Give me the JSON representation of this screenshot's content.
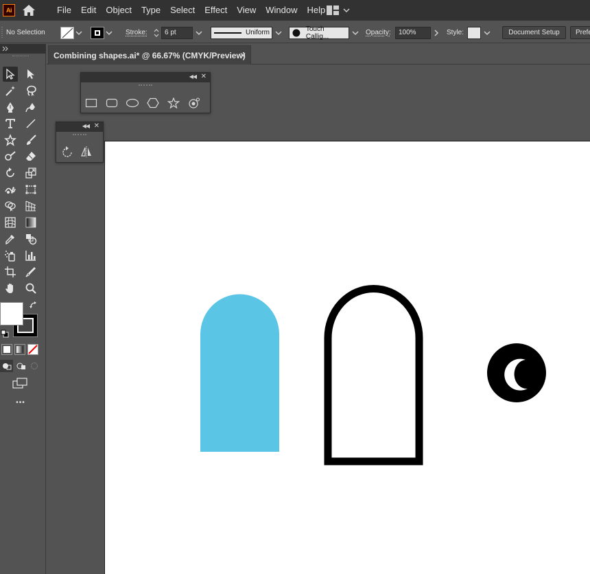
{
  "app": {
    "logo_text": "Ai",
    "menu": [
      "File",
      "Edit",
      "Object",
      "Type",
      "Select",
      "Effect",
      "View",
      "Window",
      "Help"
    ]
  },
  "control_bar": {
    "selection_label": "No Selection",
    "stroke_label": "Stroke:",
    "stroke_value": "6 pt",
    "profile_label": "Uniform",
    "brush_label": "Touch Callig...",
    "opacity_label": "Opacity:",
    "opacity_value": "100%",
    "style_label": "Style:",
    "document_setup_label": "Document Setup",
    "preferences_label": "Prefe"
  },
  "document": {
    "tab_title": "Combining shapes.ai* @ 66.67% (CMYK/Preview)",
    "close_glyph": "✕"
  },
  "colors": {
    "shape_blue": "#5bc5e6",
    "stroke_black": "#000000",
    "ui_dark": "#323232",
    "ui_mid": "#535353"
  },
  "tools_panel": {
    "more_label": "•••"
  }
}
